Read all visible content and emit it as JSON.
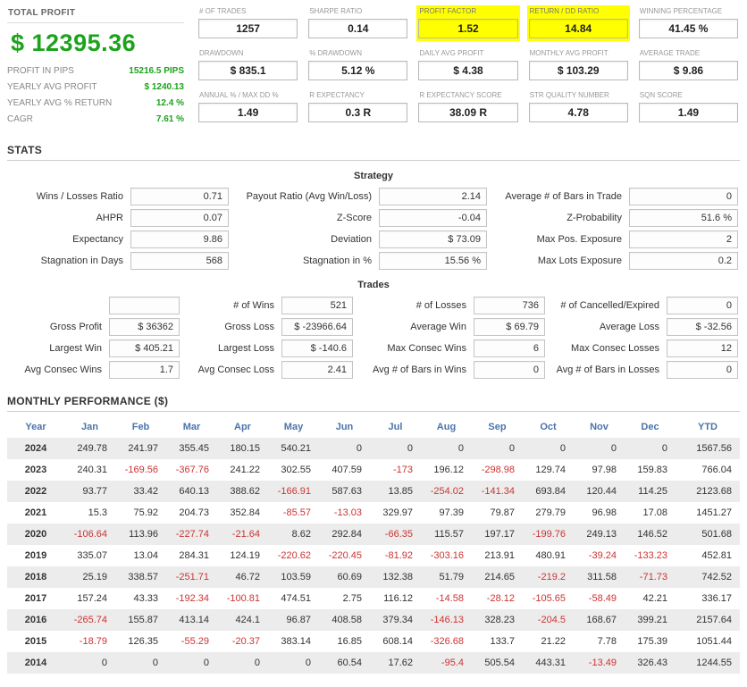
{
  "colors": {
    "green": "#1ca31c",
    "red": "#cc3333",
    "blue": "#4a74ab",
    "yellow": "#ffff00"
  },
  "summary": {
    "title": "TOTAL PROFIT",
    "total": "$ 12395.36",
    "rows": [
      {
        "label": "PROFIT IN PIPS",
        "value": "15216.5 PIPS"
      },
      {
        "label": "YEARLY AVG PROFIT",
        "value": "$ 1240.13"
      },
      {
        "label": "YEARLY AVG % RETURN",
        "value": "12.4 %"
      },
      {
        "label": "CAGR",
        "value": "7.61 %"
      }
    ]
  },
  "metrics": [
    {
      "label": "# OF TRADES",
      "value": "1257",
      "highlight": false
    },
    {
      "label": "SHARPE RATIO",
      "value": "0.14",
      "highlight": false
    },
    {
      "label": "PROFIT FACTOR",
      "value": "1.52",
      "highlight": true
    },
    {
      "label": "RETURN / DD RATIO",
      "value": "14.84",
      "highlight": true
    },
    {
      "label": "WINNING PERCENTAGE",
      "value": "41.45 %",
      "highlight": false
    },
    {
      "label": "DRAWDOWN",
      "value": "$ 835.1",
      "highlight": false
    },
    {
      "label": "% DRAWDOWN",
      "value": "5.12 %",
      "highlight": false
    },
    {
      "label": "DAILY AVG PROFIT",
      "value": "$ 4.38",
      "highlight": false
    },
    {
      "label": "MONTHLY AVG PROFIT",
      "value": "$ 103.29",
      "highlight": false
    },
    {
      "label": "AVERAGE TRADE",
      "value": "$ 9.86",
      "highlight": false
    },
    {
      "label": "ANNUAL % / MAX DD %",
      "value": "1.49",
      "highlight": false
    },
    {
      "label": "R EXPECTANCY",
      "value": "0.3 R",
      "highlight": false
    },
    {
      "label": "R EXPECTANCY SCORE",
      "value": "38.09 R",
      "highlight": false
    },
    {
      "label": "STR QUALITY NUMBER",
      "value": "4.78",
      "highlight": false
    },
    {
      "label": "SQN SCORE",
      "value": "1.49",
      "highlight": false
    }
  ],
  "stats": {
    "title": "STATS",
    "strategy": {
      "title": "Strategy",
      "rows": [
        [
          {
            "label": "Wins / Losses Ratio",
            "value": "0.71"
          },
          {
            "label": "Payout Ratio (Avg Win/Loss)",
            "value": "2.14"
          },
          {
            "label": "Average # of Bars in Trade",
            "value": "0"
          }
        ],
        [
          {
            "label": "AHPR",
            "value": "0.07"
          },
          {
            "label": "Z-Score",
            "value": "-0.04"
          },
          {
            "label": "Z-Probability",
            "value": "51.6 %"
          }
        ],
        [
          {
            "label": "Expectancy",
            "value": "9.86"
          },
          {
            "label": "Deviation",
            "value": "$ 73.09"
          },
          {
            "label": "Max Pos. Exposure",
            "value": "2"
          }
        ],
        [
          {
            "label": "Stagnation in Days",
            "value": "568"
          },
          {
            "label": "Stagnation in %",
            "value": "15.56 %"
          },
          {
            "label": "Max Lots Exposure",
            "value": "0.2"
          }
        ]
      ]
    },
    "trades": {
      "title": "Trades",
      "rows": [
        [
          {
            "label": "",
            "value": ""
          },
          {
            "label": "# of Wins",
            "value": "521"
          },
          {
            "label": "# of Losses",
            "value": "736"
          },
          {
            "label": "# of Cancelled/Expired",
            "value": "0"
          }
        ],
        [
          {
            "label": "Gross Profit",
            "value": "$ 36362"
          },
          {
            "label": "Gross Loss",
            "value": "$ -23966.64"
          },
          {
            "label": "Average Win",
            "value": "$ 69.79"
          },
          {
            "label": "Average Loss",
            "value": "$ -32.56"
          }
        ],
        [
          {
            "label": "Largest Win",
            "value": "$ 405.21"
          },
          {
            "label": "Largest Loss",
            "value": "$ -140.6"
          },
          {
            "label": "Max Consec Wins",
            "value": "6"
          },
          {
            "label": "Max Consec Losses",
            "value": "12"
          }
        ],
        [
          {
            "label": "Avg Consec Wins",
            "value": "1.7"
          },
          {
            "label": "Avg Consec Loss",
            "value": "2.41"
          },
          {
            "label": "Avg # of Bars in Wins",
            "value": "0"
          },
          {
            "label": "Avg # of Bars in Losses",
            "value": "0"
          }
        ]
      ]
    }
  },
  "monthly": {
    "title": "MONTHLY PERFORMANCE ($)",
    "columns": [
      "Year",
      "Jan",
      "Feb",
      "Mar",
      "Apr",
      "May",
      "Jun",
      "Jul",
      "Aug",
      "Sep",
      "Oct",
      "Nov",
      "Dec",
      "YTD"
    ],
    "rows": [
      {
        "year": "2024",
        "values": [
          "249.78",
          "241.97",
          "355.45",
          "180.15",
          "540.21",
          "0",
          "0",
          "0",
          "0",
          "0",
          "0",
          "0",
          "1567.56"
        ]
      },
      {
        "year": "2023",
        "values": [
          "240.31",
          "-169.56",
          "-367.76",
          "241.22",
          "302.55",
          "407.59",
          "-173",
          "196.12",
          "-298.98",
          "129.74",
          "97.98",
          "159.83",
          "766.04"
        ]
      },
      {
        "year": "2022",
        "values": [
          "93.77",
          "33.42",
          "640.13",
          "388.62",
          "-166.91",
          "587.63",
          "13.85",
          "-254.02",
          "-141.34",
          "693.84",
          "120.44",
          "114.25",
          "2123.68"
        ]
      },
      {
        "year": "2021",
        "values": [
          "15.3",
          "75.92",
          "204.73",
          "352.84",
          "-85.57",
          "-13.03",
          "329.97",
          "97.39",
          "79.87",
          "279.79",
          "96.98",
          "17.08",
          "1451.27"
        ]
      },
      {
        "year": "2020",
        "values": [
          "-106.64",
          "113.96",
          "-227.74",
          "-21.64",
          "8.62",
          "292.84",
          "-66.35",
          "115.57",
          "197.17",
          "-199.76",
          "249.13",
          "146.52",
          "501.68"
        ]
      },
      {
        "year": "2019",
        "values": [
          "335.07",
          "13.04",
          "284.31",
          "124.19",
          "-220.62",
          "-220.45",
          "-81.92",
          "-303.16",
          "213.91",
          "480.91",
          "-39.24",
          "-133.23",
          "452.81"
        ]
      },
      {
        "year": "2018",
        "values": [
          "25.19",
          "338.57",
          "-251.71",
          "46.72",
          "103.59",
          "60.69",
          "132.38",
          "51.79",
          "214.65",
          "-219.2",
          "311.58",
          "-71.73",
          "742.52"
        ]
      },
      {
        "year": "2017",
        "values": [
          "157.24",
          "43.33",
          "-192.34",
          "-100.81",
          "474.51",
          "2.75",
          "116.12",
          "-14.58",
          "-28.12",
          "-105.65",
          "-58.49",
          "42.21",
          "336.17"
        ]
      },
      {
        "year": "2016",
        "values": [
          "-265.74",
          "155.87",
          "413.14",
          "424.1",
          "96.87",
          "408.58",
          "379.34",
          "-146.13",
          "328.23",
          "-204.5",
          "168.67",
          "399.21",
          "2157.64"
        ]
      },
      {
        "year": "2015",
        "values": [
          "-18.79",
          "126.35",
          "-55.29",
          "-20.37",
          "383.14",
          "16.85",
          "608.14",
          "-326.68",
          "133.7",
          "21.22",
          "7.78",
          "175.39",
          "1051.44"
        ]
      },
      {
        "year": "2014",
        "values": [
          "0",
          "0",
          "0",
          "0",
          "0",
          "60.54",
          "17.62",
          "-95.4",
          "505.54",
          "443.31",
          "-13.49",
          "326.43",
          "1244.55"
        ]
      }
    ]
  }
}
